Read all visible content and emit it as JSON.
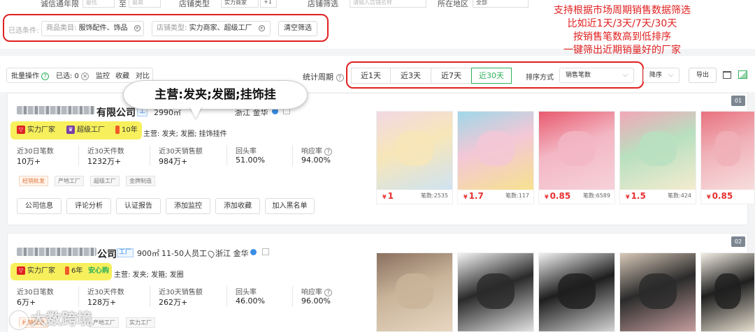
{
  "top_row": {
    "labels": [
      "诚信通年限",
      "至",
      "店铺类型",
      "店铺筛选",
      "所在地区"
    ],
    "inputs": [
      "最低",
      "最高"
    ],
    "shop_type_value": "实力商家",
    "shop_type_more": "+1",
    "shop_filter_placeholder": "请输入店铺名称",
    "region_value": "全部"
  },
  "filters": {
    "selected_label": "已选条件:",
    "chips": [
      {
        "label": "商品类目:",
        "value": "服饰配件、饰品"
      },
      {
        "label": "店铺类型:",
        "value": "实力商家、超级工厂"
      }
    ],
    "clear_label": "清空筛选"
  },
  "annotation": [
    "支持根据市场周期销售数据筛选",
    "比如近1天/3天/7天/30天",
    "按销售笔数高到低排序",
    "一键筛出近期销量好的厂家"
  ],
  "toolbar": {
    "batch_label": "批量操作",
    "selected_label": "已选: 0",
    "monitor_label": "监控",
    "favorite_label": "收藏",
    "compare_label": "对比",
    "period_label": "统计周期",
    "periods": [
      "近1天",
      "近3天",
      "近7天",
      "近30天"
    ],
    "active_period": "近30天",
    "sort_label": "排序方式",
    "sort_value": "销售笔数",
    "order_value": "降序",
    "export_label": "导出"
  },
  "bubble_text": "主营:发夹;发圈;挂饰挂",
  "cards": [
    {
      "num": "01",
      "name_suffix": "有限公司",
      "factory_tag": "工",
      "area": "2990㎡",
      "location": "浙江 金华",
      "badges": [
        "实力厂家",
        "超级工厂",
        "10年"
      ],
      "main_business": "主营: 发夹; 发圈; 挂饰挂件",
      "stats": [
        {
          "label": "近30日笔数",
          "value": "10万+"
        },
        {
          "label": "近30天件数",
          "value": "1232万+"
        },
        {
          "label": "近30天销售额",
          "value": "984万+"
        },
        {
          "label": "回头率",
          "value": "51.00%"
        },
        {
          "label": "响应率",
          "value": "94.00%"
        }
      ],
      "tags": [
        "经销批发",
        "产地工厂",
        "超级工厂",
        "金牌制造"
      ],
      "actions": [
        "公司信息",
        "评论分析",
        "认证报告",
        "添加监控",
        "添加收藏",
        "加入黑名单"
      ],
      "products": [
        {
          "price": "1",
          "sold": "笔数:2535",
          "colors": [
            "#f2d8e4",
            "#f7e6b8",
            "#cfe3f2"
          ]
        },
        {
          "price": "1.7",
          "sold": "笔数:117",
          "colors": [
            "#9fd8e8",
            "#f4c7d6",
            "#f6e28f"
          ]
        },
        {
          "price": "0.85",
          "sold": "笔数:6589",
          "colors": [
            "#e85a6e",
            "#f3b7c4",
            "#f6d2da"
          ]
        },
        {
          "price": "1.5",
          "sold": "笔数:424",
          "colors": [
            "#f2a7b8",
            "#b8e0c0",
            "#f5ecd0"
          ]
        },
        {
          "price": "0.85",
          "sold": "",
          "colors": [
            "#e8727e",
            "#f0b0b8",
            "#f7dede"
          ]
        }
      ]
    },
    {
      "num": "02",
      "name_suffix": "公司",
      "factory_tag": "工厂",
      "area": "900㎡",
      "staff": "11-50人员工",
      "location": "浙江 金华",
      "badges": [
        "实力厂家",
        "6年",
        "安心购"
      ],
      "main_business": "主营: 发夹; 发箍; 发圈",
      "stats": [
        {
          "label": "近30日笔数",
          "value": "6万+"
        },
        {
          "label": "近30天件数",
          "value": "128万+"
        },
        {
          "label": "近30天销售额",
          "value": "262万+"
        },
        {
          "label": "回头率",
          "value": "46.00%"
        },
        {
          "label": "响应率",
          "value": "96.00%"
        }
      ],
      "tags": [
        "经销批发",
        "产地工厂",
        "实力工厂"
      ],
      "products": [
        {
          "colors": [
            "#8a7060",
            "#c9b49a",
            "#e8d7c2"
          ]
        },
        {
          "colors": [
            "#f4f4f4",
            "#2a2a2a",
            "#e6e6e6"
          ]
        },
        {
          "colors": [
            "#f2f2f2",
            "#1e1e1e",
            "#d8d8d8"
          ]
        },
        {
          "colors": [
            "#d8c8b8",
            "#2b2b2b",
            "#c9a0a0"
          ]
        },
        {
          "colors": [
            "#f4eee4",
            "#1f1f1f",
            "#ece4d4"
          ]
        }
      ]
    }
  ],
  "watermark": "大数跨境"
}
